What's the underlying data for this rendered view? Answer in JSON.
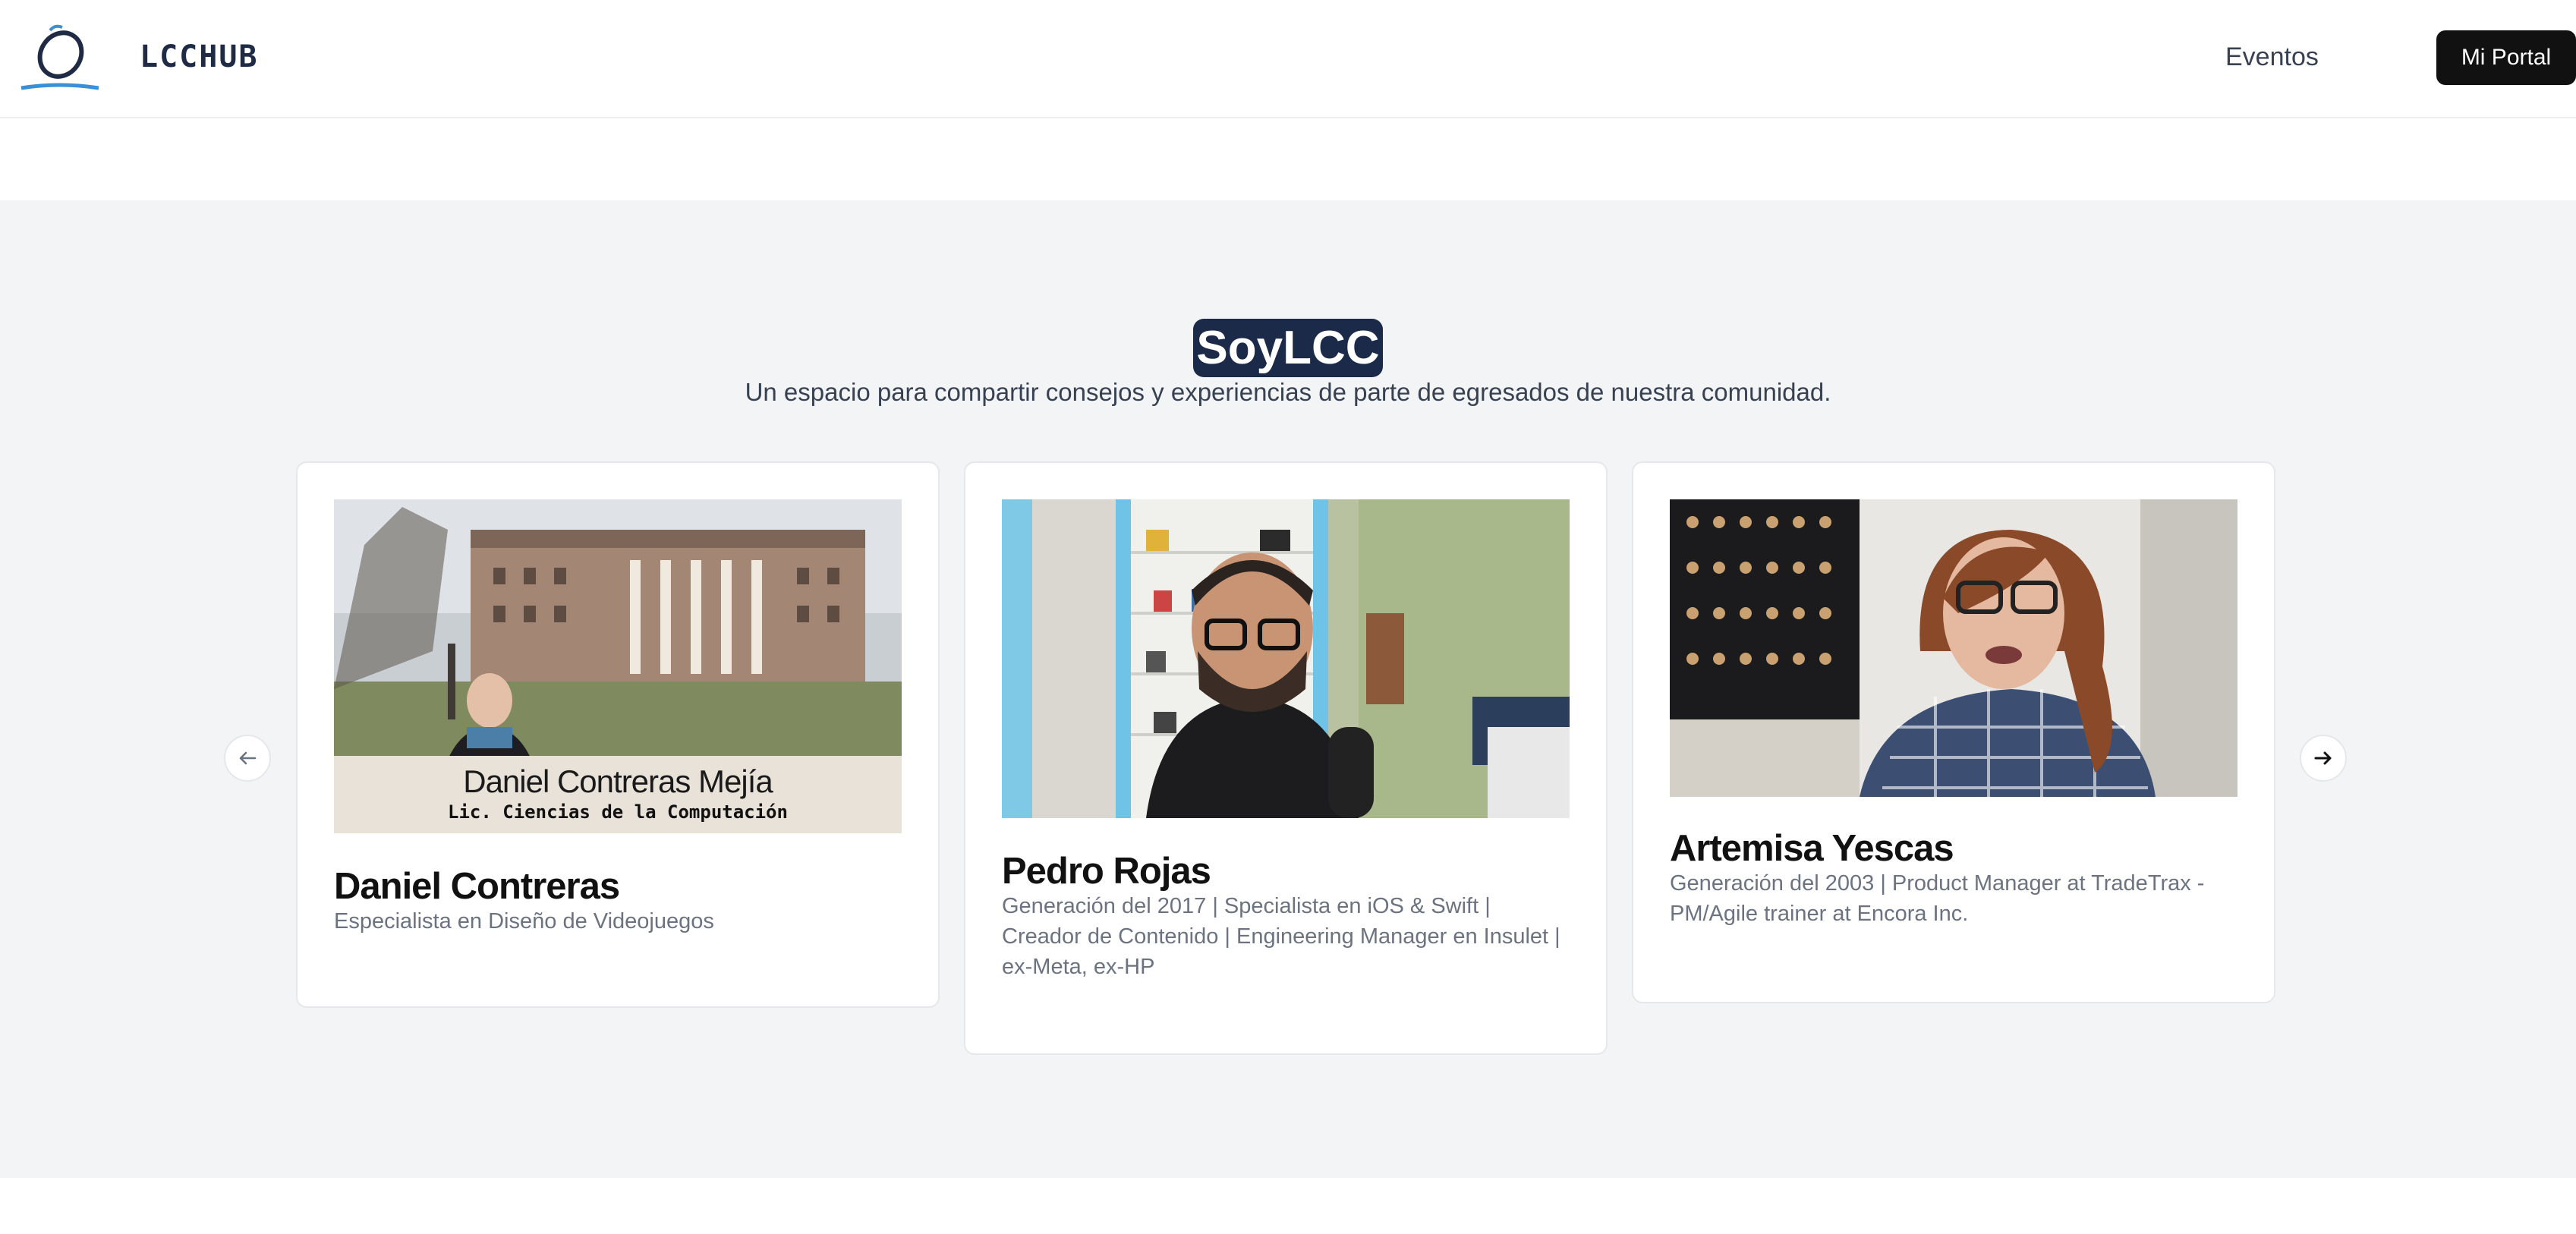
{
  "header": {
    "brand": "LCCHUB",
    "nav": {
      "eventos": "Eventos"
    },
    "portal_button": "Mi Portal"
  },
  "section": {
    "title": "SoyLCC",
    "subtitle": "Un espacio para compartir consejos y experiencias de parte de egresados de nuestra comunidad."
  },
  "cards": [
    {
      "name": "Daniel Contreras",
      "description": "Especialista en Diseño de Videojuegos",
      "image_caption_name": "Daniel Contreras Mejía",
      "image_caption_degree": "Lic. Ciencias de la Computación"
    },
    {
      "name": "Pedro Rojas",
      "description": "Generación del 2017 | Specialista en iOS & Swift | Creador de Contenido | Engineering Manager en Insulet | ex-Meta, ex-HP"
    },
    {
      "name": "Artemisa Yescas",
      "description": "Generación del 2003 | Product Manager at TradeTrax - PM/Agile trainer at Encora Inc."
    }
  ],
  "carousel": {
    "prev_icon": "arrow-left-icon",
    "next_icon": "arrow-right-icon"
  },
  "colors": {
    "title_bg": "#1c2a4a",
    "portal_button_bg": "#111111",
    "section_bg": "#f3f4f6"
  }
}
